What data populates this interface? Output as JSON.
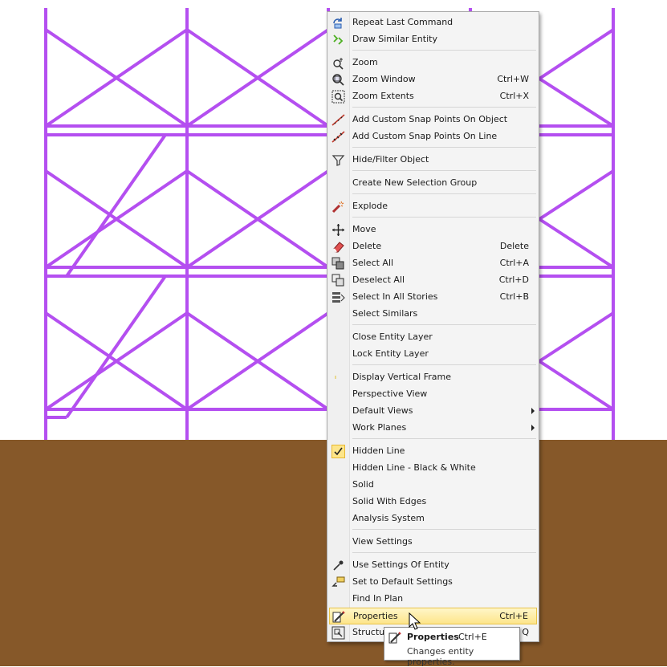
{
  "colors": {
    "frame": "#b44ff0",
    "ground": "#865829",
    "menu_bg": "#f4f4f4",
    "highlight": "#fde58a"
  },
  "menu": {
    "items": [
      {
        "label": "Repeat Last Command",
        "shortcut": "",
        "icon": "repeat-icon"
      },
      {
        "label": "Draw Similar Entity",
        "shortcut": "",
        "icon": "draw-similar-icon"
      },
      {
        "label": "Zoom",
        "shortcut": "",
        "icon": "zoom-icon"
      },
      {
        "label": "Zoom Window",
        "shortcut": "Ctrl+W",
        "icon": "zoom-window-icon"
      },
      {
        "label": "Zoom Extents",
        "shortcut": "Ctrl+X",
        "icon": "zoom-extents-icon"
      },
      {
        "label": "Add Custom Snap Points On Object",
        "shortcut": "",
        "icon": "snap-object-icon"
      },
      {
        "label": "Add Custom Snap Points On Line",
        "shortcut": "",
        "icon": "snap-line-icon"
      },
      {
        "label": "Hide/Filter Object",
        "shortcut": "",
        "icon": "filter-icon"
      },
      {
        "label": "Create New Selection Group",
        "shortcut": "",
        "icon": ""
      },
      {
        "label": "Explode",
        "shortcut": "",
        "icon": "explode-icon"
      },
      {
        "label": "Move",
        "shortcut": "",
        "icon": "move-icon"
      },
      {
        "label": "Delete",
        "shortcut": "Delete",
        "icon": "eraser-icon"
      },
      {
        "label": "Select All",
        "shortcut": "Ctrl+A",
        "icon": "select-all-icon"
      },
      {
        "label": "Deselect All",
        "shortcut": "Ctrl+D",
        "icon": "deselect-all-icon"
      },
      {
        "label": "Select In All Stories",
        "shortcut": "Ctrl+B",
        "icon": "select-stories-icon"
      },
      {
        "label": "Select Similars",
        "shortcut": "",
        "icon": ""
      },
      {
        "label": "Close Entity Layer",
        "shortcut": "",
        "icon": ""
      },
      {
        "label": "Lock Entity Layer",
        "shortcut": "",
        "icon": ""
      },
      {
        "label": "Display Vertical Frame",
        "shortcut": "",
        "icon": "vertical-frame-icon"
      },
      {
        "label": "Perspective View",
        "shortcut": "",
        "icon": ""
      },
      {
        "label": "Default Views",
        "shortcut": "",
        "icon": "",
        "submenu": true
      },
      {
        "label": "Work Planes",
        "shortcut": "",
        "icon": "",
        "submenu": true
      },
      {
        "label": "Hidden Line",
        "shortcut": "",
        "icon": "checkmark-icon"
      },
      {
        "label": "Hidden Line - Black & White",
        "shortcut": "",
        "icon": ""
      },
      {
        "label": "Solid",
        "shortcut": "",
        "icon": ""
      },
      {
        "label": "Solid With Edges",
        "shortcut": "",
        "icon": ""
      },
      {
        "label": "Analysis System",
        "shortcut": "",
        "icon": ""
      },
      {
        "label": "View Settings",
        "shortcut": "",
        "icon": ""
      },
      {
        "label": "Use Settings Of Entity",
        "shortcut": "",
        "icon": "eyedropper-icon"
      },
      {
        "label": "Set to Default Settings",
        "shortcut": "",
        "icon": "default-settings-icon"
      },
      {
        "label": "Find In Plan",
        "shortcut": "",
        "icon": ""
      },
      {
        "label": "Properties",
        "shortcut": "Ctrl+E",
        "icon": "properties-icon"
      },
      {
        "label": "Structu",
        "shortcut": "Q",
        "icon": "structure-icon"
      }
    ]
  },
  "tooltip": {
    "title": "Properties",
    "shortcut": "Ctrl+E",
    "description": "Changes entity properties."
  }
}
